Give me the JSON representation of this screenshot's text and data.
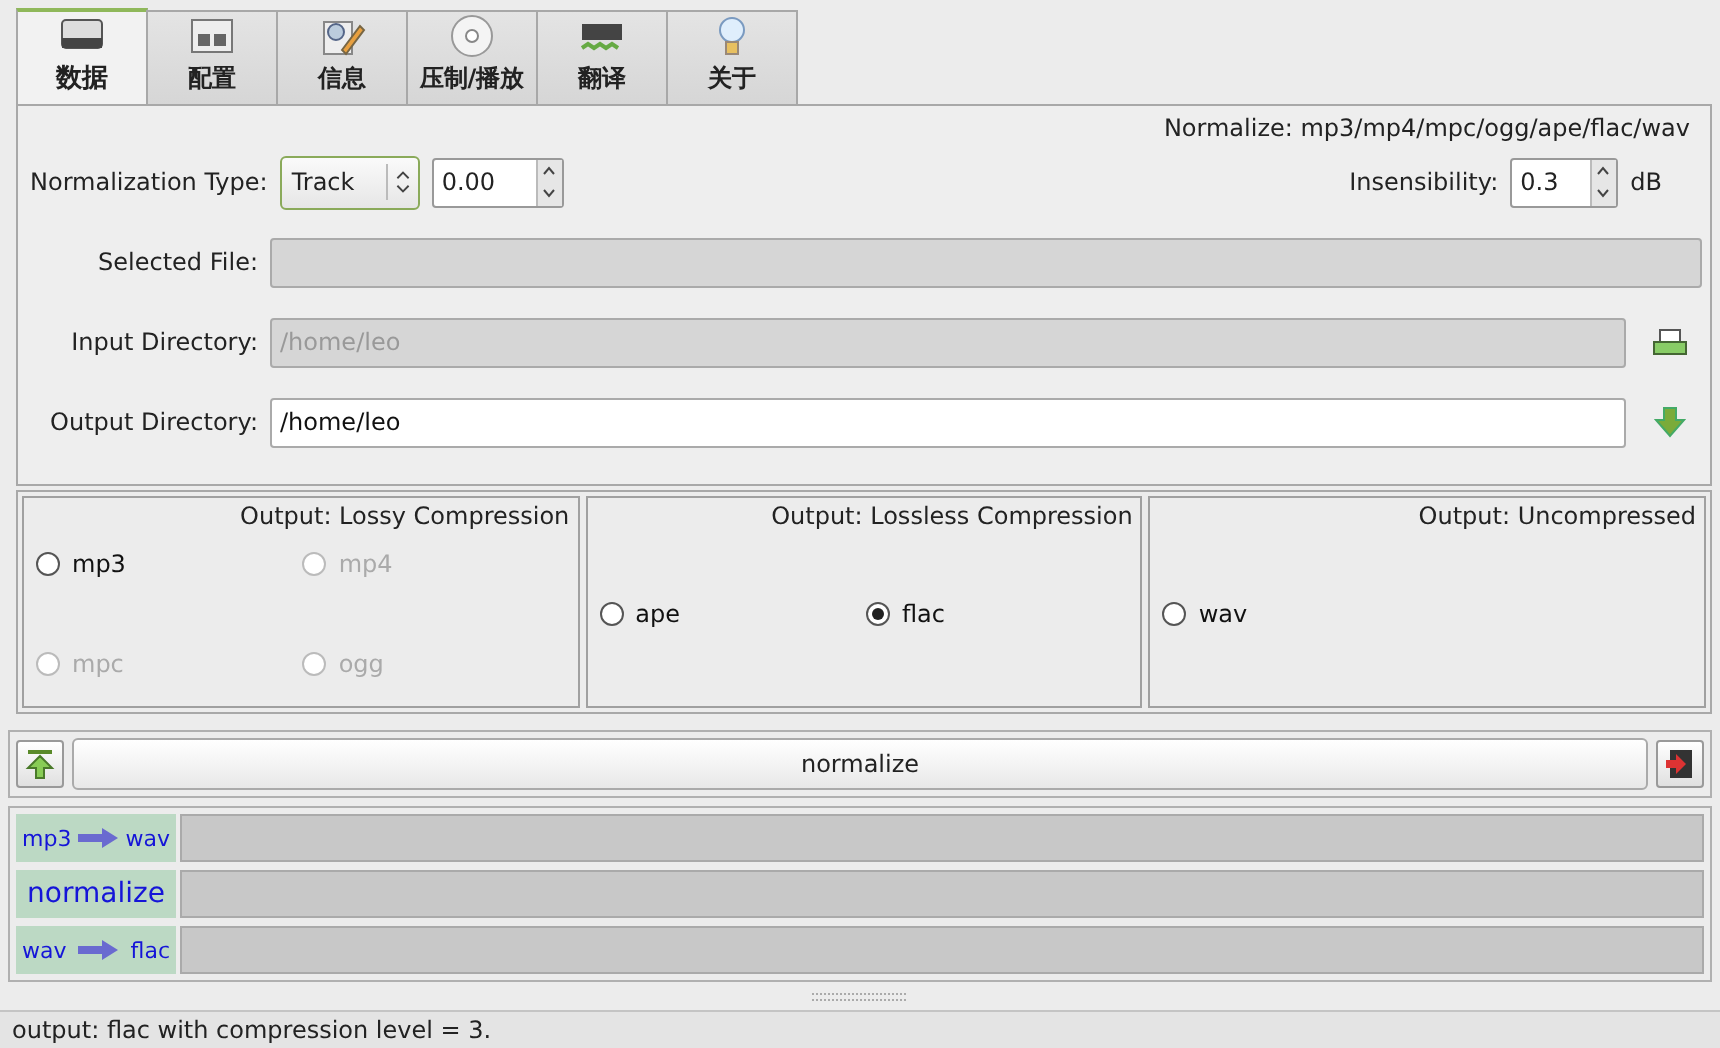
{
  "tabs": [
    {
      "label": "数据",
      "selected": true
    },
    {
      "label": "配置",
      "selected": false
    },
    {
      "label": "信息",
      "selected": false
    },
    {
      "label": "压制/播放",
      "selected": false
    },
    {
      "label": "翻译",
      "selected": false
    },
    {
      "label": "关于",
      "selected": false
    }
  ],
  "form": {
    "title": "Normalize: mp3/mp4/mpc/ogg/ape/flac/wav",
    "normalization_type": {
      "label": "Normalization Type:",
      "value": "Track",
      "amount": "0.00"
    },
    "insensibility": {
      "label": "Insensibility:",
      "value": "0.3",
      "unit": "dB"
    },
    "fields": [
      {
        "label": "Selected File:",
        "disabled": true
      },
      {
        "label": "Input Directory:",
        "value": "/home/leo",
        "disabled": true
      },
      {
        "label": "Output Directory:",
        "value": "/home/leo",
        "disabled": false
      }
    ]
  },
  "groups": [
    {
      "title": "Output: Lossy Compression",
      "options": [
        {
          "label": "mp3",
          "selected": false,
          "disabled": false
        },
        {
          "label": "mp4",
          "selected": false,
          "disabled": true
        },
        {
          "label": "mpc",
          "selected": false,
          "disabled": true
        },
        {
          "label": "ogg",
          "selected": false,
          "disabled": true
        }
      ]
    },
    {
      "title": "Output: Lossless Compression",
      "options": [
        {
          "label": "ape",
          "selected": false,
          "disabled": false
        },
        {
          "label": "flac",
          "selected": true,
          "disabled": false
        }
      ]
    },
    {
      "title": "Output: Uncompressed",
      "options": [
        {
          "label": "wav",
          "selected": false,
          "disabled": false
        }
      ]
    }
  ],
  "action_button": "normalize",
  "progress": [
    {
      "kind": "convert",
      "from": "mp3",
      "to": "wav",
      "level": 0
    },
    {
      "kind": "step",
      "label": "normalize",
      "level": 0
    },
    {
      "kind": "convert",
      "from": "wav",
      "to": "flac",
      "level": 0
    }
  ],
  "status_bar": "output: flac with compression level = 3."
}
